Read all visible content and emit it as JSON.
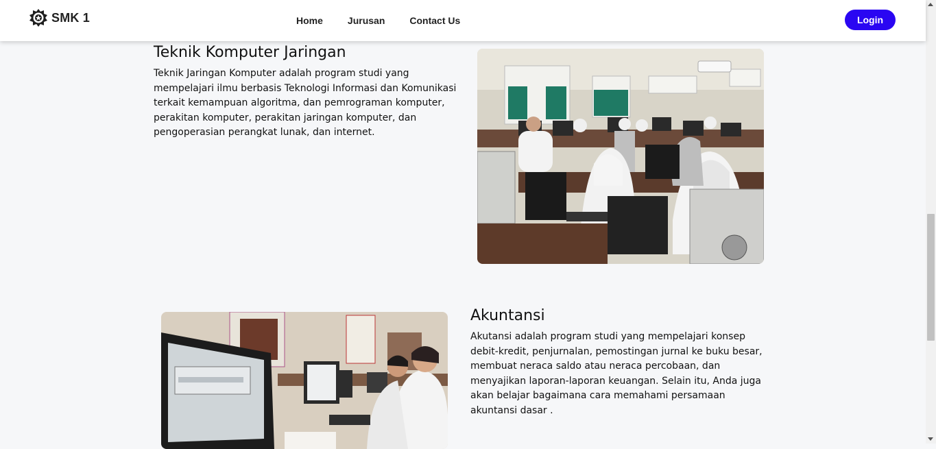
{
  "navbar": {
    "brand": "SMK 1",
    "links": [
      "Home",
      "Jurusan",
      "Contact Us"
    ],
    "login_label": "Login",
    "login_color": "#2a06f2"
  },
  "sections": [
    {
      "title": "Teknik Komputer Jaringan",
      "description": "Teknik Jaringan Komputer adalah program studi yang mempelajari ilmu berbasis Teknologi Informasi dan Komunikasi terkait kemampuan algoritma, dan pemrograman komputer, perakitan komputer, perakitan jaringan komputer, dan pengoperasian perangkat lunak, dan internet.",
      "image": "computer-lab-photo"
    },
    {
      "title": "Akuntansi",
      "description": "Akutansi adalah program studi yang mempelajari konsep debit-kredit, penjurnalan, pemostingan jurnal ke buku besar, membuat neraca saldo atau neraca percobaan, dan menyajikan laporan-laporan keuangan. Selain itu, Anda juga akan belajar bagaimana cara memahami persamaan akuntansi dasar .",
      "image": "accounting-class-photo"
    }
  ]
}
